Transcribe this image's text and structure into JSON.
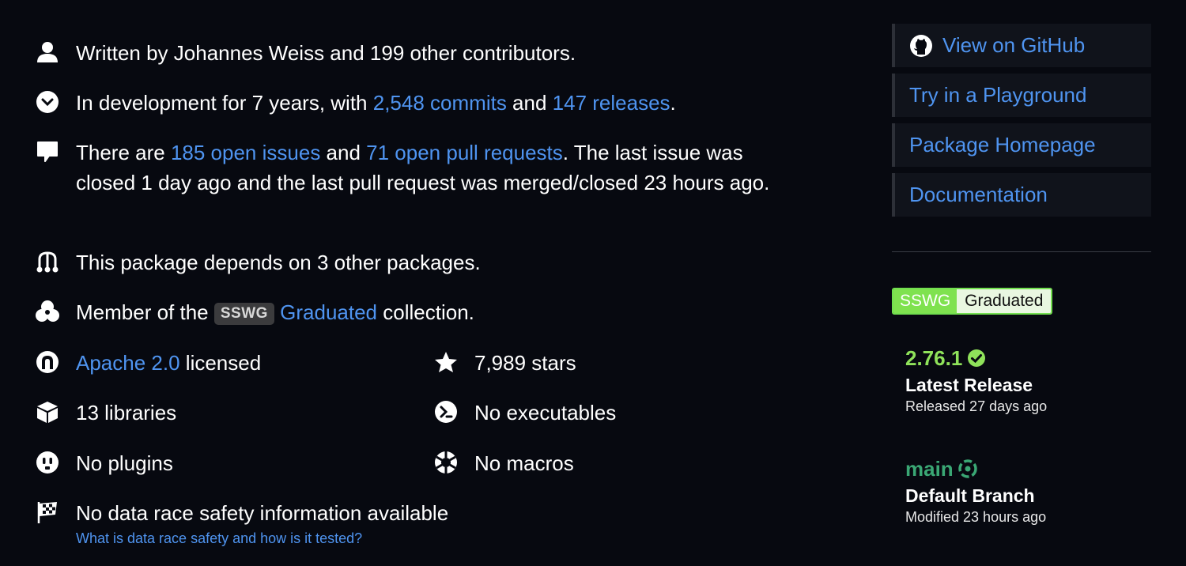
{
  "facts": {
    "contributors": {
      "prefix": "Written by Johannes Weiss and 199 other contributors."
    },
    "development": {
      "prefix": "In development for 7 years, with ",
      "commits": "2,548 commits",
      "middle": " and ",
      "releases": "147 releases",
      "suffix": "."
    },
    "issues": {
      "prefix": "There are ",
      "open_issues": "185 open issues",
      "middle": " and ",
      "open_prs": "71 open pull requests",
      "suffix": ". The last issue was closed 1 day ago and the last pull request was merged/closed 23 hours ago."
    },
    "dependencies": {
      "text": "This package depends on 3 other packages."
    },
    "collection": {
      "prefix": "Member of the ",
      "badge": "SSWG",
      "link": "Graduated",
      "suffix": " collection."
    },
    "license": {
      "link": "Apache 2.0",
      "suffix": " licensed"
    },
    "stars": {
      "text": "7,989 stars"
    },
    "libraries": {
      "text": "13 libraries"
    },
    "executables": {
      "text": "No executables"
    },
    "plugins": {
      "text": "No plugins"
    },
    "macros": {
      "text": "No macros"
    },
    "data_race": {
      "text": "No data race safety information available",
      "link": "What is data race safety and how is it tested?"
    }
  },
  "sidebar": {
    "links": [
      "View on GitHub",
      "Try in a Playground",
      "Package Homepage",
      "Documentation"
    ]
  },
  "sswg_badge": {
    "left": "SSWG",
    "right": "Graduated"
  },
  "latest_release": {
    "version": "2.76.1",
    "title": "Latest Release",
    "meta": "Released 27 days ago"
  },
  "default_branch": {
    "name": "main",
    "title": "Default Branch",
    "meta": "Modified 23 hours ago"
  },
  "colors": {
    "link": "#4f94f0",
    "release_version": "#8fe25a",
    "branch_name": "#3aa774",
    "background": "#070910"
  }
}
